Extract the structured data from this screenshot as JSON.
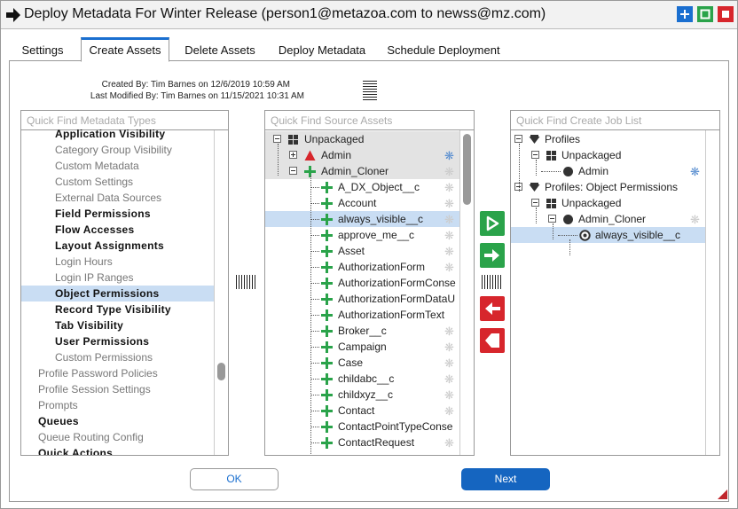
{
  "window": {
    "title": "Deploy Metadata For Winter Release (person1@metazoa.com to newss@mz.com)"
  },
  "tabs": [
    {
      "label": "Settings"
    },
    {
      "label": "Create Assets"
    },
    {
      "label": "Delete Assets"
    },
    {
      "label": "Deploy Metadata"
    },
    {
      "label": "Schedule Deployment"
    }
  ],
  "meta": {
    "created": "Created By: Tim Barnes on 12/6/2019 10:59 AM",
    "modified": "Last Modified By: Tim Barnes on 11/15/2021 10:31 AM"
  },
  "metadata_types": {
    "placeholder": "Quick Find Metadata Types",
    "items": [
      {
        "label": "Application Visibility",
        "style": "bold",
        "indent": 2
      },
      {
        "label": "Category Group Visibility",
        "style": "gray",
        "indent": 2
      },
      {
        "label": "Custom Metadata",
        "style": "gray",
        "indent": 2
      },
      {
        "label": "Custom Settings",
        "style": "gray",
        "indent": 2
      },
      {
        "label": "External Data Sources",
        "style": "gray",
        "indent": 2
      },
      {
        "label": "Field Permissions",
        "style": "bold",
        "indent": 2
      },
      {
        "label": "Flow Accesses",
        "style": "bold",
        "indent": 2
      },
      {
        "label": "Layout Assignments",
        "style": "bold",
        "indent": 2
      },
      {
        "label": "Login Hours",
        "style": "gray",
        "indent": 2
      },
      {
        "label": "Login IP Ranges",
        "style": "gray",
        "indent": 2
      },
      {
        "label": "Object Permissions",
        "style": "bold",
        "indent": 2,
        "selected": true
      },
      {
        "label": "Record Type Visibility",
        "style": "bold",
        "indent": 2
      },
      {
        "label": "Tab Visibility",
        "style": "bold",
        "indent": 2
      },
      {
        "label": "User Permissions",
        "style": "bold",
        "indent": 2
      },
      {
        "label": "Custom Permissions",
        "style": "gray",
        "indent": 2
      },
      {
        "label": "Profile Password Policies",
        "style": "gray",
        "indent": 1
      },
      {
        "label": "Profile Session Settings",
        "style": "gray",
        "indent": 1
      },
      {
        "label": "Prompts",
        "style": "gray",
        "indent": 1
      },
      {
        "label": "Queues",
        "style": "bold",
        "indent": 1
      },
      {
        "label": "Queue Routing Config",
        "style": "gray",
        "indent": 1
      },
      {
        "label": "Quick Actions",
        "style": "bold",
        "indent": 1
      }
    ]
  },
  "source_assets": {
    "placeholder": "Quick Find Source Assets",
    "root": "Unpackaged",
    "items": [
      {
        "label": "Admin",
        "icon": "warning-icon",
        "level": 1,
        "expander": "plus",
        "star": "blue"
      },
      {
        "label": "Admin_Cloner",
        "icon": "plus-icon",
        "level": 1,
        "expander": "minus",
        "star": "gray"
      },
      {
        "label": "A_DX_Object__c",
        "icon": "plus-icon",
        "level": 2,
        "star": "gray"
      },
      {
        "label": "Account",
        "icon": "plus-icon",
        "level": 2,
        "star": "gray"
      },
      {
        "label": "always_visible__c",
        "icon": "plus-icon",
        "level": 2,
        "star": "gray",
        "selected": true
      },
      {
        "label": "approve_me__c",
        "icon": "plus-icon",
        "level": 2,
        "star": "gray"
      },
      {
        "label": "Asset",
        "icon": "plus-icon",
        "level": 2,
        "star": "gray"
      },
      {
        "label": "AuthorizationForm",
        "icon": "plus-icon",
        "level": 2,
        "star": "gray"
      },
      {
        "label": "AuthorizationFormConse",
        "icon": "plus-icon",
        "level": 2
      },
      {
        "label": "AuthorizationFormDataU",
        "icon": "plus-icon",
        "level": 2
      },
      {
        "label": "AuthorizationFormText",
        "icon": "plus-icon",
        "level": 2
      },
      {
        "label": "Broker__c",
        "icon": "plus-icon",
        "level": 2,
        "star": "gray"
      },
      {
        "label": "Campaign",
        "icon": "plus-icon",
        "level": 2,
        "star": "gray"
      },
      {
        "label": "Case",
        "icon": "plus-icon",
        "level": 2,
        "star": "gray"
      },
      {
        "label": "childabc__c",
        "icon": "plus-icon",
        "level": 2,
        "star": "gray"
      },
      {
        "label": "childxyz__c",
        "icon": "plus-icon",
        "level": 2,
        "star": "gray"
      },
      {
        "label": "Contact",
        "icon": "plus-icon",
        "level": 2,
        "star": "gray"
      },
      {
        "label": "ContactPointTypeConse",
        "icon": "plus-icon",
        "level": 2
      },
      {
        "label": "ContactRequest",
        "icon": "plus-icon",
        "level": 2,
        "star": "gray"
      }
    ]
  },
  "job_list": {
    "placeholder": "Quick Find Create Job List",
    "items": [
      {
        "label": "Profiles",
        "icon": "funnel-icon",
        "level": 0,
        "expander": "minus"
      },
      {
        "label": "Unpackaged",
        "icon": "package-icon",
        "level": 1,
        "expander": "minus"
      },
      {
        "label": "Admin",
        "icon": "dot-icon",
        "level": 2,
        "star": "blue"
      },
      {
        "label": "Profiles: Object Permissions",
        "icon": "funnel-icon",
        "level": 0,
        "expander": "minus"
      },
      {
        "label": "Unpackaged",
        "icon": "package-icon",
        "level": 1,
        "expander": "minus"
      },
      {
        "label": "Admin_Cloner",
        "icon": "dot-icon",
        "level": 2,
        "expander": "minus",
        "star": "gray"
      },
      {
        "label": "always_visible__c",
        "icon": "ring-icon",
        "level": 3,
        "selected": true
      }
    ]
  },
  "buttons": {
    "ok": "OK",
    "next": "Next"
  },
  "colors": {
    "accent": "#1a6fd0",
    "green": "#2aa34a",
    "red": "#d7262c",
    "selection": "#c9ddf3"
  }
}
